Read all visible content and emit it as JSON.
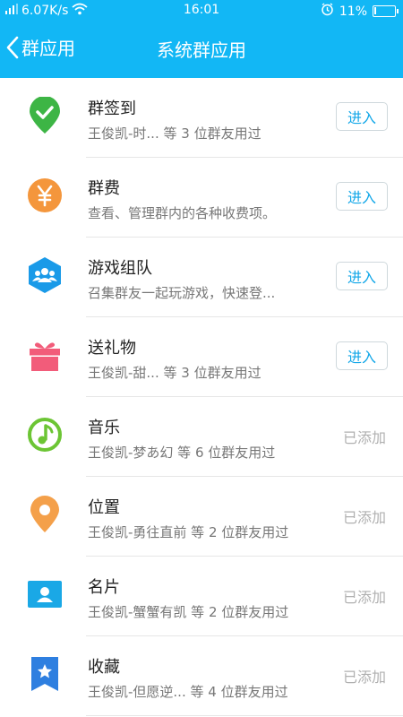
{
  "status_bar": {
    "network_speed": "6.07K/s",
    "time": "16:01",
    "battery": "11%",
    "battery_level": 0.11
  },
  "nav": {
    "back_label": "群应用",
    "title": "系统群应用"
  },
  "apps": [
    {
      "title": "群签到",
      "subtitle": "王俊凯-时...    等 3 位群友用过",
      "action": "进入",
      "icon": "check-pin-icon",
      "color": "#3db545"
    },
    {
      "title": "群费",
      "subtitle": "查看、管理群内的各种收费项。",
      "action": "进入",
      "icon": "yuan-coin-icon",
      "color": "#f4963c"
    },
    {
      "title": "游戏组队",
      "subtitle": "召集群友一起玩游戏，快速登...",
      "action": "进入",
      "icon": "team-hexagon-icon",
      "color": "#1a9ae8"
    },
    {
      "title": "送礼物",
      "subtitle": "王俊凯-甜...    等 3 位群友用过",
      "action": "进入",
      "icon": "gift-icon",
      "color": "#f25c7a"
    },
    {
      "title": "音乐",
      "subtitle": "王俊凯-梦あ幻 等 6 位群友用过",
      "action": "已添加",
      "icon": "music-note-icon",
      "color": "#6cc534"
    },
    {
      "title": "位置",
      "subtitle": "王俊凯-勇往直前 等 2 位群友用过",
      "action": "已添加",
      "icon": "location-pin-icon",
      "color": "#f4a04a"
    },
    {
      "title": "名片",
      "subtitle": "王俊凯-蟹蟹有凯 等 2 位群友用过",
      "action": "已添加",
      "icon": "contact-card-icon",
      "color": "#1aa8e6"
    },
    {
      "title": "收藏",
      "subtitle": "王俊凯-但愿逆...    等 4 位群友用过",
      "action": "已添加",
      "icon": "bookmark-star-icon",
      "color": "#2e7fe0"
    }
  ]
}
